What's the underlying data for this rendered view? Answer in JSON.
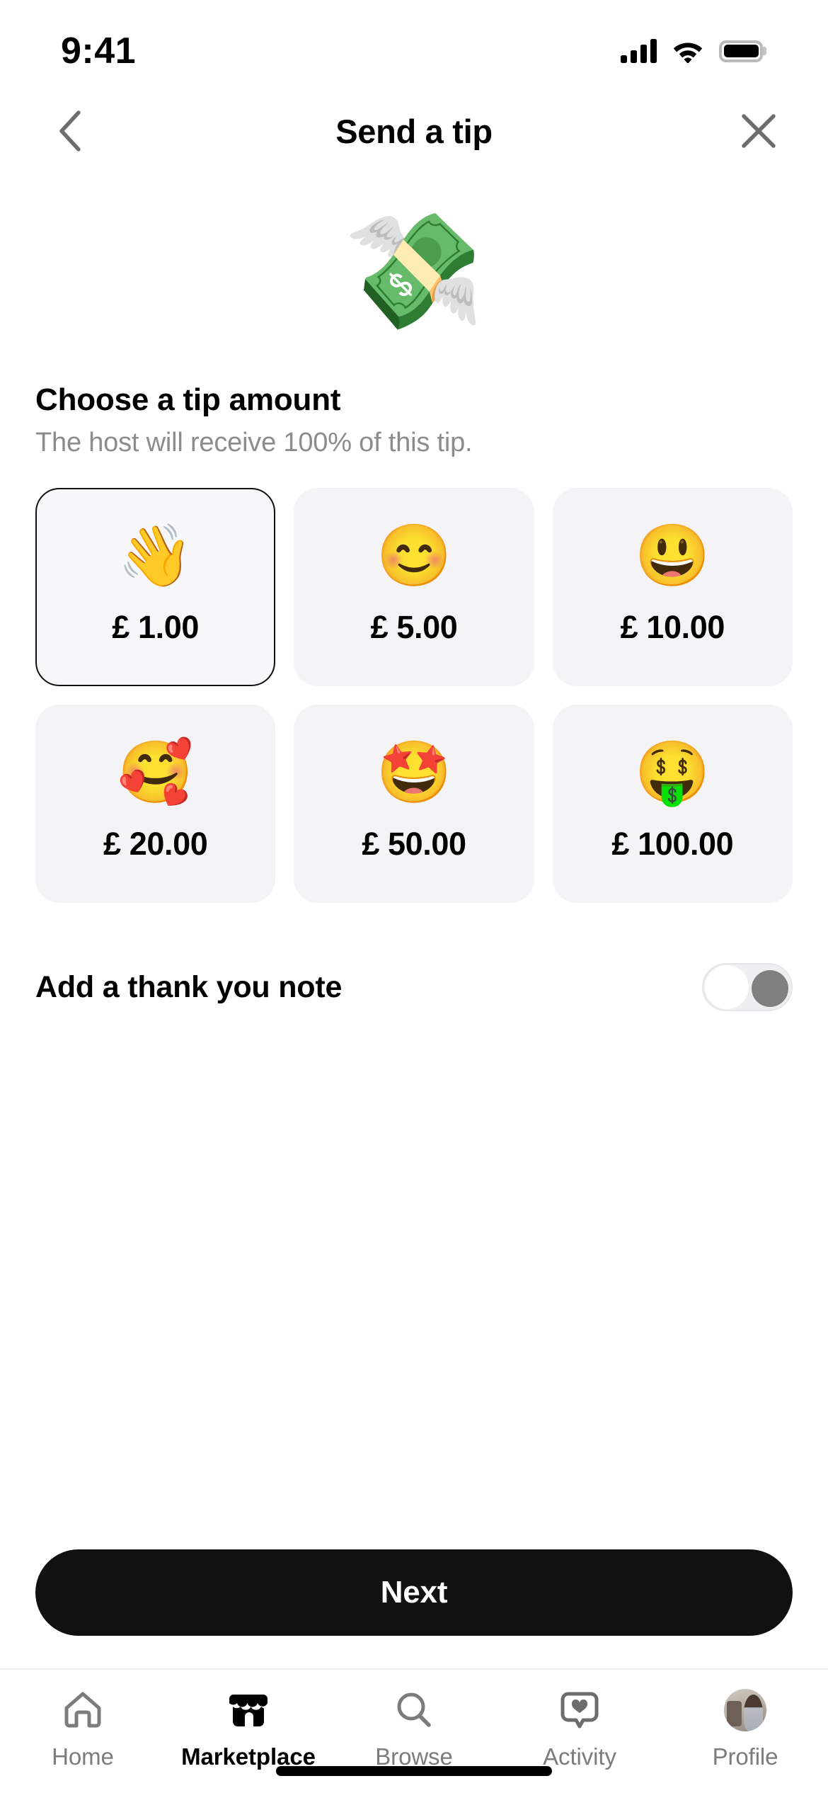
{
  "status_bar": {
    "time": "9:41",
    "icons": [
      "cellular-signal-icon",
      "wifi-icon",
      "battery-icon"
    ]
  },
  "nav": {
    "title": "Send a tip",
    "back_icon": "chevron-left-icon",
    "close_icon": "close-icon"
  },
  "hero": {
    "emoji": "💸",
    "emoji_name": "money-with-wings-emoji"
  },
  "main": {
    "heading": "Choose a tip amount",
    "subheading": "The host will receive 100% of this tip.",
    "tips": [
      {
        "emoji": "👋",
        "emoji_name": "waving-hand-emoji",
        "amount": "£ 1.00",
        "selected": true
      },
      {
        "emoji": "😊",
        "emoji_name": "smiling-face-emoji",
        "amount": "£ 5.00",
        "selected": false
      },
      {
        "emoji": "😃",
        "emoji_name": "grinning-face-emoji",
        "amount": "£ 10.00",
        "selected": false
      },
      {
        "emoji": "🥰",
        "emoji_name": "smiling-face-hearts-emoji",
        "amount": "£ 20.00",
        "selected": false
      },
      {
        "emoji": "🤩",
        "emoji_name": "star-struck-emoji",
        "amount": "£ 50.00",
        "selected": false
      },
      {
        "emoji": "🤑",
        "emoji_name": "money-mouth-face-emoji",
        "amount": "£ 100.00",
        "selected": false
      }
    ],
    "note_toggle": {
      "label": "Add a thank you note",
      "enabled": false
    }
  },
  "cta": {
    "label": "Next"
  },
  "tabbar": {
    "items": [
      {
        "label": "Home",
        "icon": "home-icon",
        "active": false
      },
      {
        "label": "Marketplace",
        "icon": "storefront-icon",
        "active": true
      },
      {
        "label": "Browse",
        "icon": "search-icon",
        "active": false
      },
      {
        "label": "Activity",
        "icon": "heart-bubble-icon",
        "active": false
      },
      {
        "label": "Profile",
        "icon": "avatar-icon",
        "active": false
      }
    ]
  },
  "colors": {
    "accent": "#111111",
    "card_bg": "#f4f3f6",
    "muted_text": "#8c8c8c",
    "tab_inactive": "#7c7c7c",
    "toggle_knob": "#808080"
  }
}
